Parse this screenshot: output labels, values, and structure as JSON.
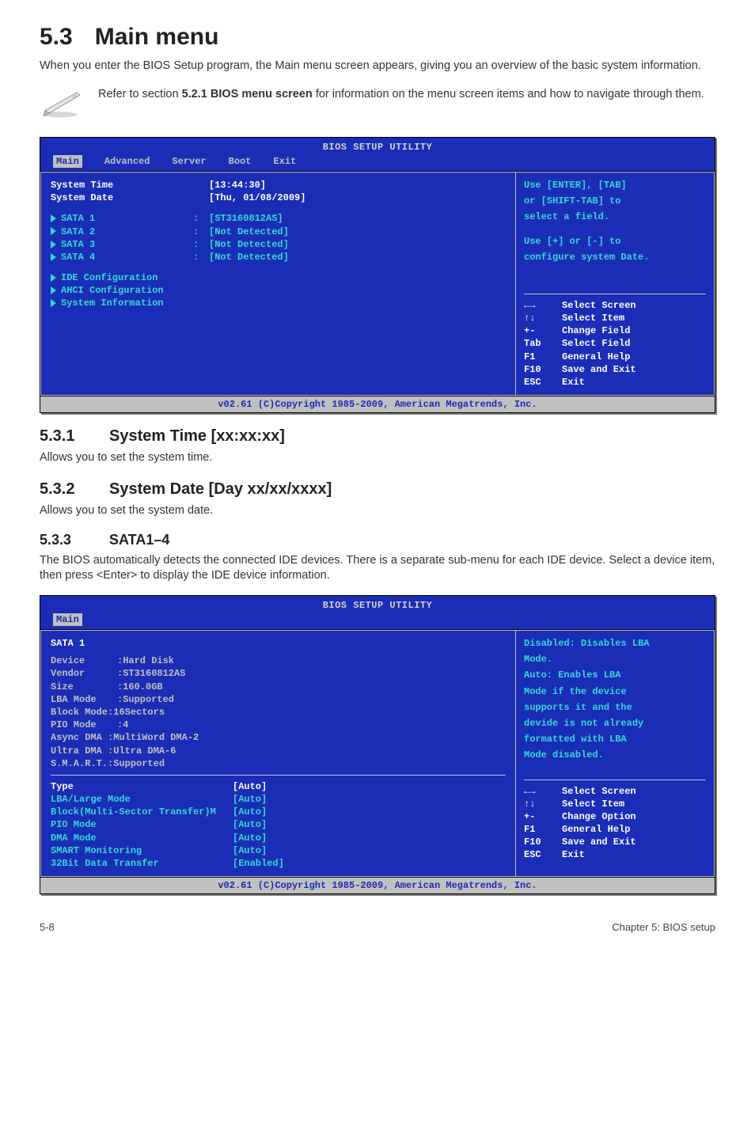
{
  "heading": {
    "num": "5.3",
    "title": "Main menu"
  },
  "intro": "When you enter the BIOS Setup program, the Main menu screen appears, giving you an overview of the basic system information.",
  "note": {
    "prefix": "Refer to section ",
    "bold": "5.2.1 BIOS menu screen",
    "suffix": " for information on the menu screen items and how to navigate through them."
  },
  "bios1": {
    "title": "BIOS SETUP UTILITY",
    "tabs": [
      "Main",
      "Advanced",
      "Server",
      "Boot",
      "Exit"
    ],
    "activeTab": "Main",
    "left": {
      "systemTimeLabel": "System Time",
      "systemTimeValue": "[13:44:30]",
      "systemDateLabel": "System Date",
      "systemDateValue": "[Thu, 01/08/2009]",
      "sata": [
        {
          "label": "SATA 1",
          "value": "[ST3160812AS]"
        },
        {
          "label": "SATA 2",
          "value": "[Not Detected]"
        },
        {
          "label": "SATA 3",
          "value": "[Not Detected]"
        },
        {
          "label": "SATA 4",
          "value": "[Not Detected]"
        }
      ],
      "subs": [
        "IDE Configuration",
        "AHCI Configuration",
        "System Information"
      ]
    },
    "right": {
      "help1": "Use [ENTER], [TAB]",
      "help2": "or [SHIFT-TAB] to",
      "help3": "select a field.",
      "help4": "Use [+] or [-] to",
      "help5": "configure system Date.",
      "hints": [
        {
          "k": "←→",
          "d": "Select Screen"
        },
        {
          "k": "↑↓",
          "d": "Select Item"
        },
        {
          "k": "+-",
          "d": "Change Field"
        },
        {
          "k": "Tab",
          "d": "Select Field"
        },
        {
          "k": "F1",
          "d": "General Help"
        },
        {
          "k": "F10",
          "d": "Save and Exit"
        },
        {
          "k": "ESC",
          "d": "Exit"
        }
      ]
    },
    "footer": "v02.61 (C)Copyright 1985-2009, American Megatrends, Inc."
  },
  "sub1": {
    "num": "5.3.1",
    "title": "System Time [xx:xx:xx]",
    "body": "Allows you to set the system time."
  },
  "sub2": {
    "num": "5.3.2",
    "title": "System Date [Day xx/xx/xxxx]",
    "body": "Allows you to set the system date."
  },
  "sub3": {
    "num": "5.3.3",
    "title": "SATA1–4",
    "body": "The BIOS automatically detects the connected IDE devices. There is a separate sub-menu for each IDE device. Select a device item, then press <Enter> to display the IDE device information."
  },
  "bios2": {
    "title": "BIOS SETUP UTILITY",
    "tabs": [
      "Main"
    ],
    "activeTab": "Main",
    "header": "SATA 1",
    "info": [
      {
        "label": "Device",
        "value": ":Hard Disk"
      },
      {
        "label": "Vendor",
        "value": ":ST3160812AS"
      },
      {
        "label": "Size",
        "value": ":160.0GB"
      },
      {
        "label": "LBA Mode",
        "value": ":Supported"
      },
      {
        "label": "Block Mode:16Sectors",
        "value": ""
      },
      {
        "label": "PIO Mode",
        "value": ":4"
      },
      {
        "label": "Async DMA :MultiWord DMA-2",
        "value": ""
      },
      {
        "label": "Ultra DMA :Ultra DMA-6",
        "value": ""
      },
      {
        "label": "S.M.A.R.T.:Supported",
        "value": ""
      }
    ],
    "settings": [
      {
        "label": "Type",
        "value": "[Auto]"
      },
      {
        "label": "LBA/Large Mode",
        "value": "[Auto]"
      },
      {
        "label": "Block(Multi-Sector Transfer)M",
        "value": "[Auto]"
      },
      {
        "label": "PIO Mode",
        "value": "[Auto]"
      },
      {
        "label": "DMA Mode",
        "value": "[Auto]"
      },
      {
        "label": "SMART Monitoring",
        "value": "[Auto]"
      },
      {
        "label": "32Bit Data Transfer",
        "value": "[Enabled]"
      }
    ],
    "right": {
      "help": [
        "Disabled: Disables LBA",
        "Mode.",
        "Auto: Enables LBA",
        "Mode if the device",
        "supports it and the",
        "devide is not already",
        "formatted with LBA",
        "Mode disabled."
      ],
      "hints": [
        {
          "k": "←→",
          "d": "Select Screen"
        },
        {
          "k": "↑↓",
          "d": "Select Item"
        },
        {
          "k": "+-",
          "d": "Change Option"
        },
        {
          "k": "F1",
          "d": "General Help"
        },
        {
          "k": "F10",
          "d": "Save and Exit"
        },
        {
          "k": "ESC",
          "d": "Exit"
        }
      ]
    },
    "footer": "v02.61 (C)Copyright 1985-2009, American Megatrends, Inc."
  },
  "pageFooter": {
    "left": "5-8",
    "right": "Chapter 5: BIOS setup"
  }
}
